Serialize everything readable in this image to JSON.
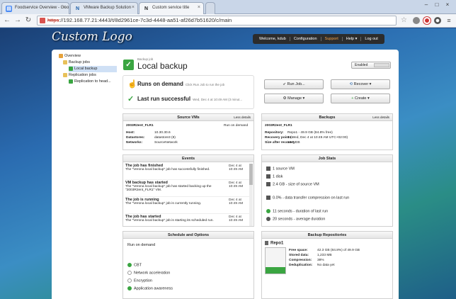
{
  "browser": {
    "tabs": [
      {
        "label": "Foodservice Overview - Goo",
        "icon": "google-docs-icon",
        "active": false
      },
      {
        "label": "VMware Backup Solution",
        "icon": "nakivo-icon",
        "active": false
      },
      {
        "label": "Custom service title",
        "icon": "nakivo-icon",
        "active": true
      }
    ],
    "url_scheme": "https",
    "url_rest": "://192.168.77.21:4443/t/8d2961ce-7c3d-4448-aa51-af26d7b51620/c/main"
  },
  "header": {
    "logo_text": "Custom Logo",
    "nav": [
      "Welcome, kdub",
      "Configuration",
      "Support",
      "Help ▾",
      "Log out"
    ]
  },
  "tree": {
    "items": [
      {
        "label": "Overview",
        "level": 0
      },
      {
        "label": "Backup jobs",
        "level": 1
      },
      {
        "label": "Local backup",
        "level": 2,
        "selected": true
      },
      {
        "label": "Replication jobs",
        "level": 1
      },
      {
        "label": "Replication to head...",
        "level": 2
      }
    ]
  },
  "job": {
    "type_label": "Backup job",
    "name": "Local backup",
    "enabled_label": "Enabled",
    "run_mode": "Runs on demand",
    "run_mode_hint": "Click Run Job to run the job",
    "last_run": "Last run successful",
    "last_run_detail": "Wed, Dec 4 at 10:49 AM (3 minut..."
  },
  "buttons": {
    "run_job": "Run Job...",
    "recover": "Recover ▾",
    "manage": "Manage ▾",
    "create": "Create ▾"
  },
  "source_vms": {
    "title": "Source VMs",
    "less": "Less details",
    "vm_name": "2003R2ent_FLR1",
    "vm_action": "Run on demand",
    "host_label": "Host:",
    "host": "10.30.30.6",
    "datastores_label": "Datastores:",
    "datastores": "datastore3 (8)",
    "networks_label": "Networks:",
    "networks": "SourceNetwork"
  },
  "backups": {
    "title": "Backups",
    "less": "Less details",
    "vm_name": "2003R2ent_FLR1",
    "repo_label": "Repository:",
    "repo": "Repo1 - 49.9 GB (84.8% free)",
    "points_label": "Recovery points:",
    "points": "1 (Wed, Dec 4 at 10:49 AM UTC+02:00)",
    "size_label": "Size after recovery:",
    "size": "10.0 GB"
  },
  "events": {
    "title": "Events",
    "items": [
      {
        "title": "The job has finished",
        "body": "The \"Verona local backup\" job has successfully finished.",
        "date": "Dec 4 at 10:49 AM"
      },
      {
        "title": "VM backup has started",
        "body": "The \"Verona local backup\" job has started backing up the \"2003R2ent_FLR1\" VM.",
        "date": "Dec 4 at 10:49 AM"
      },
      {
        "title": "The job is running",
        "body": "The \"Verona local backup\" job is currently running.",
        "date": "Dec 4 at 10:49 AM"
      },
      {
        "title": "The job has started",
        "body": "The \"Verona local backup\" job is starting its scheduled run.",
        "date": "Dec 4 at 10:49 AM"
      }
    ]
  },
  "job_stats": {
    "title": "Job Stats",
    "items": [
      "1 source VM",
      "1 disk",
      "2.4 GB - size of source VM",
      "0.0% - data transfer compression on last run",
      "11 seconds - duration of last run",
      "20 seconds - average duration"
    ]
  },
  "schedule": {
    "title": "Schedule and Options",
    "mode": "Run on demand",
    "options": [
      "CBT",
      "Network acceleration",
      "Encryption",
      "Application awareness"
    ]
  },
  "repos": {
    "title": "Backup Repositories",
    "name": "Repo1",
    "free_label": "Free space:",
    "free": "42.3 GB (84.8%) of 49.9 GB",
    "stored_label": "Stored data:",
    "stored": "1,233 MB",
    "comp_label": "Compression:",
    "comp": "38%",
    "dedup_label": "Deduplication:",
    "dedup": "No data yet",
    "free_fraction": 0.848
  },
  "colors": {
    "accent_green": "#3aa541",
    "support_orange": "#f3a34a",
    "nav_dark": "#2c2c2c"
  }
}
